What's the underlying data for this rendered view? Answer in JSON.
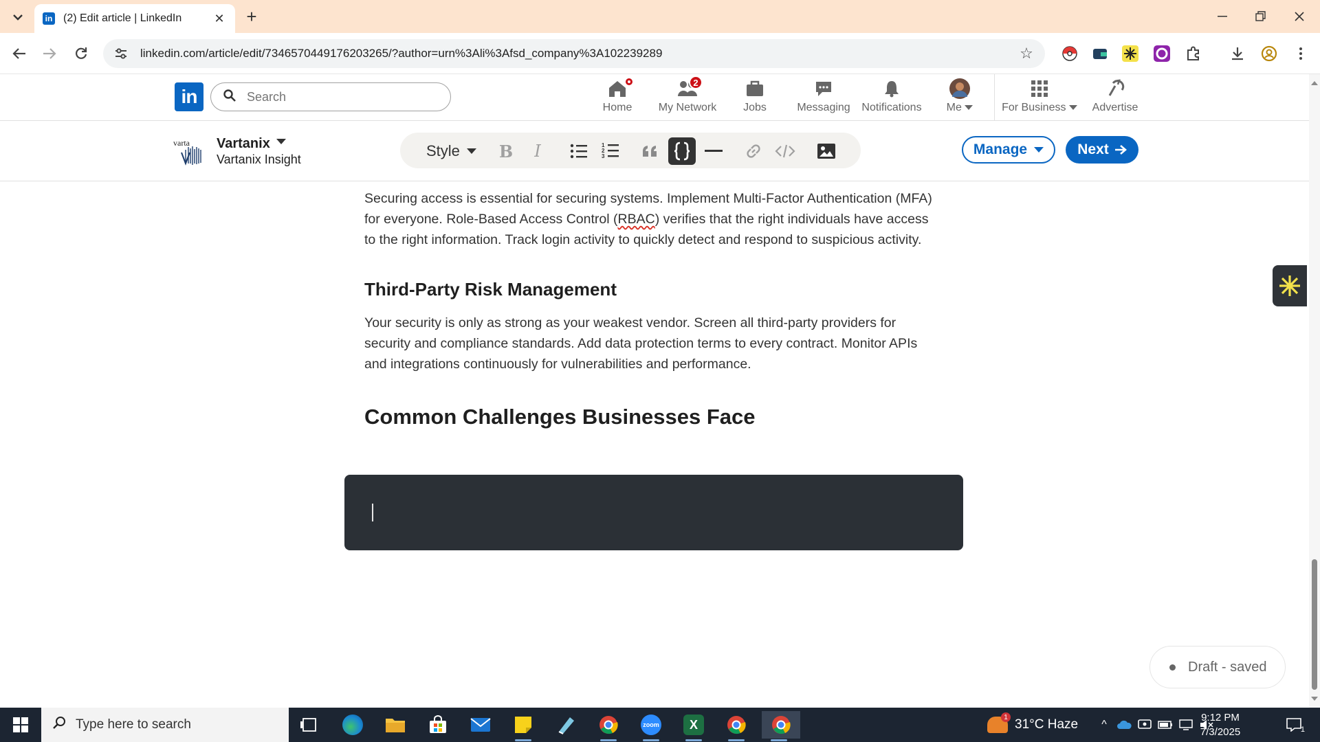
{
  "browser": {
    "tab_title": "(2) Edit article | LinkedIn",
    "url": "linkedin.com/article/edit/7346570449176203265/?author=urn%3Ali%3Afsd_company%3A102239289"
  },
  "linkedin_nav": {
    "search_placeholder": "Search",
    "items": [
      {
        "label": "Home",
        "badge": "",
        "icon": "home-icon"
      },
      {
        "label": "My Network",
        "badge": "2",
        "icon": "network-icon"
      },
      {
        "label": "Jobs",
        "badge": "",
        "icon": "briefcase-icon"
      },
      {
        "label": "Messaging",
        "badge": "",
        "icon": "chat-icon"
      },
      {
        "label": "Notifications",
        "badge": "",
        "icon": "bell-icon"
      },
      {
        "label": "Me",
        "badge": "",
        "icon": "avatar-icon"
      },
      {
        "label": "For Business",
        "badge": "",
        "icon": "grid-icon"
      },
      {
        "label": "Advertise",
        "badge": "",
        "icon": "advertise-icon"
      }
    ]
  },
  "editor": {
    "author_name": "Vartanix",
    "author_sub": "Vartanix Insight",
    "style_label": "Style",
    "manage_label": "Manage",
    "next_label": "Next"
  },
  "article": {
    "para1_before": "Securing access is essential for securing systems. Implement Multi-Factor Authentication (MFA) for everyone. Role-Based Access Control (",
    "para1_spell": "RBAC",
    "para1_after": ") verifies that the right individuals have access to the right information. Track login activity to quickly detect and respond to suspicious activity.",
    "heading2": "Third-Party Risk Management",
    "para2": "Your security is only as strong as your weakest vendor. Screen all third-party providers for security and compliance standards. Add data protection terms to every contract. Monitor APIs and integrations continuously for vulnerabilities and performance.",
    "heading1": "Common Challenges Businesses Face"
  },
  "status": {
    "draft_label": "Draft - saved"
  },
  "taskbar": {
    "search_placeholder": "Type here to search",
    "weather": "31°C  Haze",
    "weather_badge": "1",
    "time": "9:12 PM",
    "date": "7/3/2025",
    "notification_count": "1"
  },
  "colors": {
    "linkedin_blue": "#0a66c2",
    "tab_strip": "#fde4cf",
    "code_block": "#2b3036",
    "badge_red": "#cc1016",
    "taskbar": "#1c2532"
  }
}
